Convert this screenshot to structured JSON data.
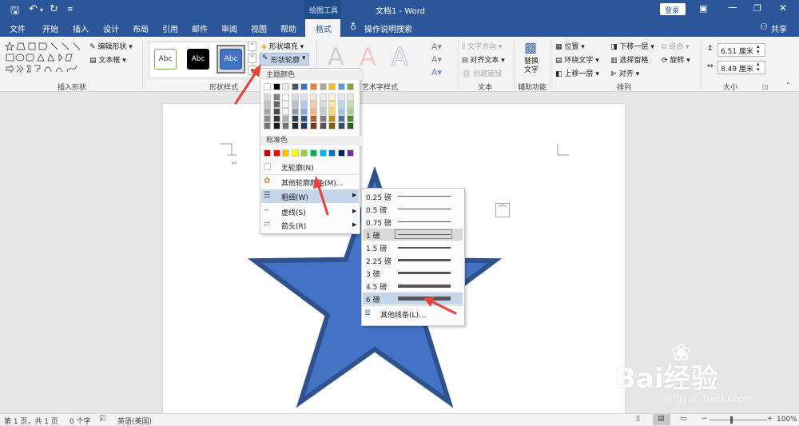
{
  "titlebar": {
    "drawing_tools": "绘图工具",
    "doc_title": "文档1 - Word",
    "login": "登录"
  },
  "tabs": [
    "文件",
    "开始",
    "插入",
    "设计",
    "布局",
    "引用",
    "邮件",
    "审阅",
    "视图",
    "帮助",
    "格式"
  ],
  "tell_me": "操作说明搜索",
  "share": "共享",
  "ribbon": {
    "insert_shapes": {
      "label": "插入形状",
      "edit_shape": "编辑形状",
      "text_box": "文本框"
    },
    "shape_styles": {
      "label": "形状样式",
      "abc": "Abc",
      "fill": "形状填充",
      "outline": "形状轮廓"
    },
    "wordart": {
      "label": "艺术字样式",
      "letter": "A"
    },
    "text": {
      "label": "文本",
      "direction": "文字方向",
      "align": "对齐文本",
      "link": "创建链接"
    },
    "accessibility": {
      "label": "辅助功能",
      "alt_text": "替换文字"
    },
    "arrange": {
      "label": "排列",
      "position": "位置",
      "wrap": "环绕文字",
      "forward": "上移一层",
      "backward": "下移一层",
      "pane": "选择窗格",
      "align": "对齐",
      "group": "组合",
      "rotate": "旋转"
    },
    "size": {
      "label": "大小",
      "height": "6.51 厘米",
      "width": "8.49 厘米"
    }
  },
  "outline_menu": {
    "theme_colors": "主题颜色",
    "standard_colors": "标准色",
    "no_outline": "无轮廓(N)",
    "more_colors": "其他轮廓颜色(M)...",
    "weight": "粗细(W)",
    "dashes": "虚线(S)",
    "arrows": "箭头(R)"
  },
  "weight_menu": {
    "items": [
      "0.25 磅",
      "0.5 磅",
      "0.75 磅",
      "1 磅",
      "1.5 磅",
      "2.25 磅",
      "3 磅",
      "4.5 磅",
      "6 磅"
    ],
    "more_lines": "其他线条(L)..."
  },
  "status": {
    "page": "第 1 页，共 1 页",
    "words": "0 个字",
    "lang": "英语(美国)",
    "zoom": "100%"
  },
  "watermark": {
    "brand": "Bai经验",
    "url": "jingyan.baidu.com"
  },
  "colors": {
    "brand": "#2b579a",
    "star_fill": "#4472c4",
    "star_stroke": "#2f528f",
    "arrow": "#e8423b",
    "theme_top": [
      "#ffffff",
      "#000000",
      "#e7e6e6",
      "#44546a",
      "#4472c4",
      "#ed7d31",
      "#a5a5a5",
      "#ffc000",
      "#5b9bd5",
      "#70ad47"
    ],
    "standard": [
      "#c00000",
      "#ff0000",
      "#ffc000",
      "#ffff00",
      "#92d050",
      "#00b050",
      "#00b0f0",
      "#0070c0",
      "#002060",
      "#7030a0"
    ]
  }
}
